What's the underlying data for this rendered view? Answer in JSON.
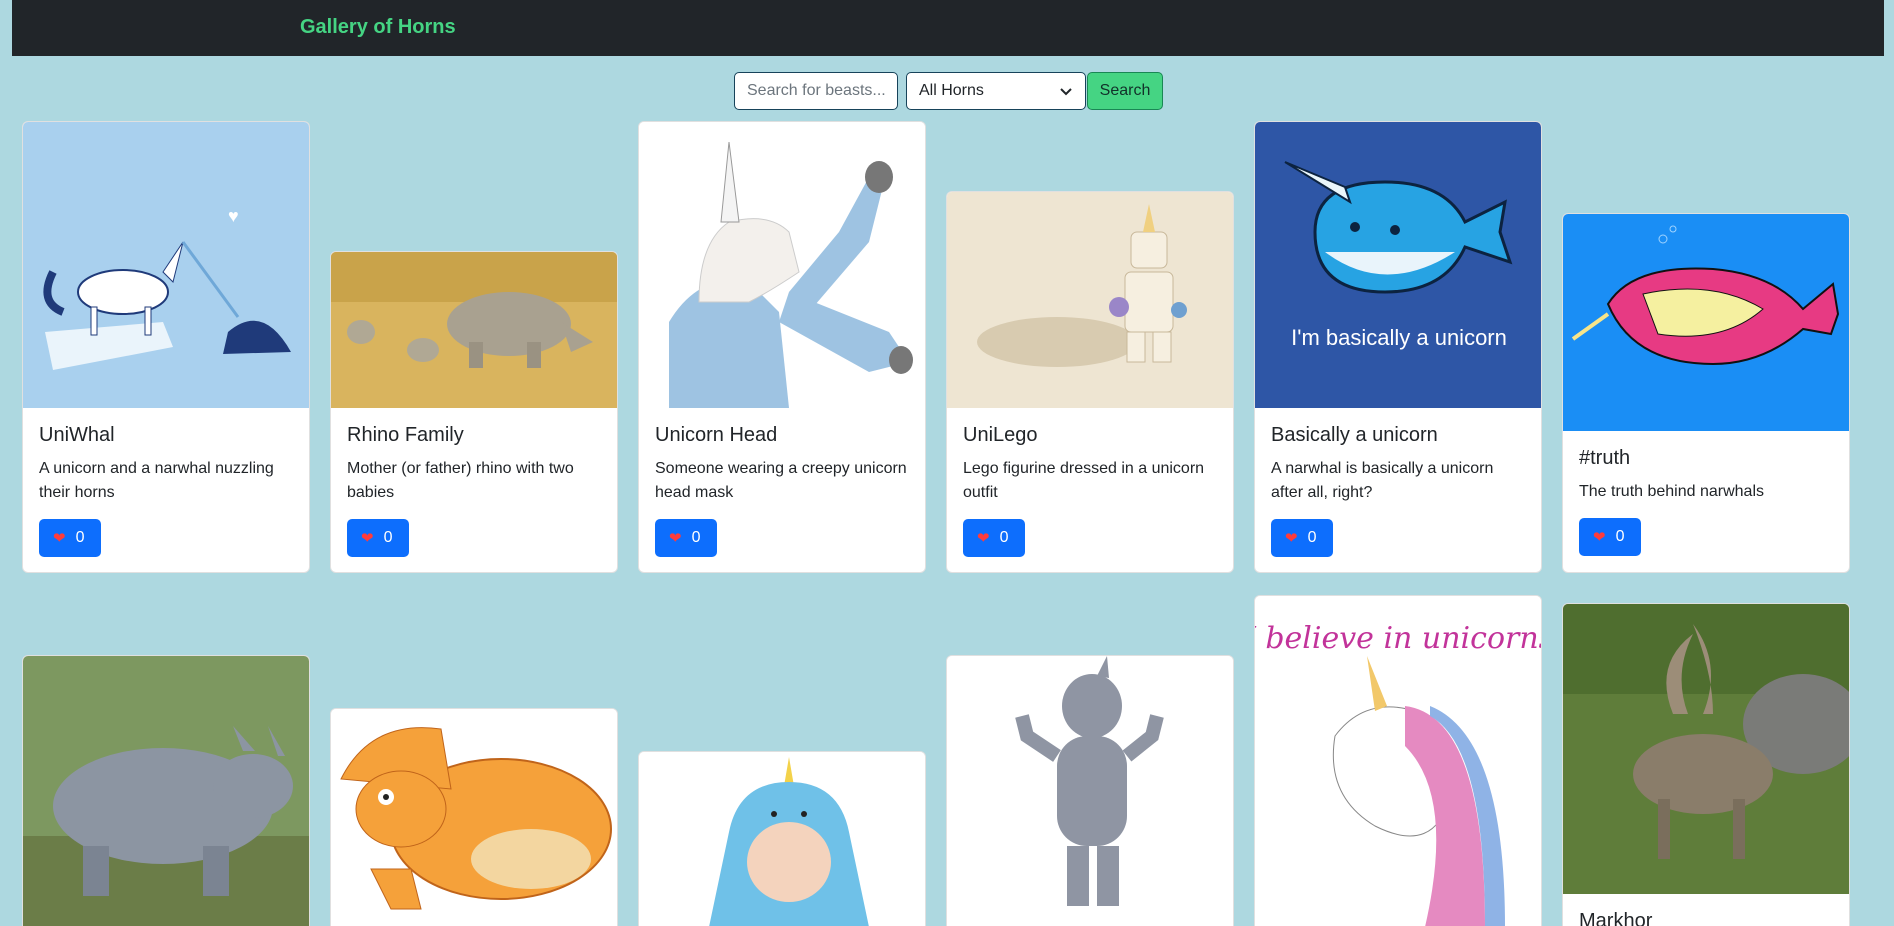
{
  "header": {
    "brand": "Gallery of Horns"
  },
  "search": {
    "placeholder": "Search for beasts...",
    "select_value": "All Horns",
    "button_label": "Search"
  },
  "cards": [
    {
      "title": "UniWhal",
      "description": "A unicorn and a narwhal nuzzling their horns",
      "likes": "0"
    },
    {
      "title": "Rhino Family",
      "description": "Mother (or father) rhino with two babies",
      "likes": "0"
    },
    {
      "title": "Unicorn Head",
      "description": "Someone wearing a creepy unicorn head mask",
      "likes": "0"
    },
    {
      "title": "UniLego",
      "description": "Lego figurine dressed in a unicorn outfit",
      "likes": "0"
    },
    {
      "title": "Basically a unicorn",
      "description": "A narwhal is basically a unicorn after all, right?",
      "likes": "0"
    },
    {
      "title": "#truth",
      "description": "The truth behind narwhals",
      "likes": "0"
    },
    {
      "title": "Markhor"
    }
  ],
  "image_text": {
    "basically_unicorn": "I'm basically a unicorn",
    "believe": "I believe in unicorns"
  },
  "colors": {
    "navbar": "#212529",
    "brand": "#45d483",
    "page_bg": "#add8e0",
    "like_button": "#0d6efd",
    "search_button": "#45d483"
  }
}
